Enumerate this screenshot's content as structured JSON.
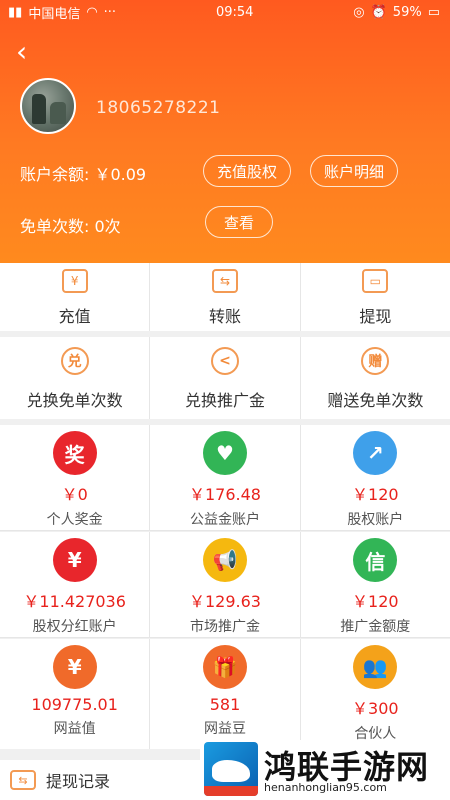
{
  "status_bar": {
    "carrier": "中国电信",
    "time": "09:54",
    "battery": "59%"
  },
  "header": {
    "phone": "18065278221",
    "balance_label": "账户余额: ￥0.09",
    "recharge_equity_btn": "充值股权",
    "account_detail_btn": "账户明细",
    "free_count_label": "免单次数: 0次",
    "view_btn": "查看"
  },
  "actions_row1": [
    {
      "icon": "yuan-wallet-icon",
      "label": "充值"
    },
    {
      "icon": "transfer-icon",
      "label": "转账"
    },
    {
      "icon": "wallet-icon",
      "label": "提现"
    }
  ],
  "actions_row2": [
    {
      "icon": "exchange-icon",
      "glyph": "兑",
      "label": "兑换免单次数"
    },
    {
      "icon": "share-icon",
      "glyph": "<",
      "label": "兑换推广金"
    },
    {
      "icon": "gift-text-icon",
      "glyph": "赠",
      "label": "赠送免单次数"
    }
  ],
  "accounts": [
    {
      "icon": "award-icon",
      "glyph": "奖",
      "color": "#e8262c",
      "amount": "￥0",
      "label": "个人奖金"
    },
    {
      "icon": "heart-hand-icon",
      "glyph": "♥",
      "color": "#32b556",
      "amount": "￥176.48",
      "label": "公益金账户"
    },
    {
      "icon": "chart-up-icon",
      "glyph": "↗",
      "color": "#3fa0ea",
      "amount": "￥120",
      "label": "股权账户"
    },
    {
      "icon": "coin-icon",
      "glyph": "¥",
      "color": "#e8262c",
      "amount": "￥11.427036",
      "label": "股权分红账户"
    },
    {
      "icon": "megaphone-icon",
      "glyph": "📢",
      "color": "#f5b80f",
      "amount": "￥129.63",
      "label": "市场推广金"
    },
    {
      "icon": "credit-icon",
      "glyph": "信",
      "color": "#32b556",
      "amount": "￥120",
      "label": "推广金额度"
    },
    {
      "icon": "coins-icon",
      "glyph": "¥",
      "color": "#f06a2a",
      "amount": "109775.01",
      "label": "网益值"
    },
    {
      "icon": "gift-icon",
      "glyph": "🎁",
      "color": "#f06a2a",
      "amount": "581",
      "label": "网益豆"
    },
    {
      "icon": "partner-icon",
      "glyph": "👥",
      "color": "#f4a21a",
      "amount": "￥300",
      "label": "合伙人"
    }
  ],
  "bottom": {
    "label": "提现记录"
  },
  "watermark": {
    "title": "鸿联手游网",
    "url": "henanhonglian95.com"
  },
  "colors": {
    "header_start": "#ff5a1f",
    "header_end": "#ff8a1e",
    "amount_red": "#e8221c"
  }
}
